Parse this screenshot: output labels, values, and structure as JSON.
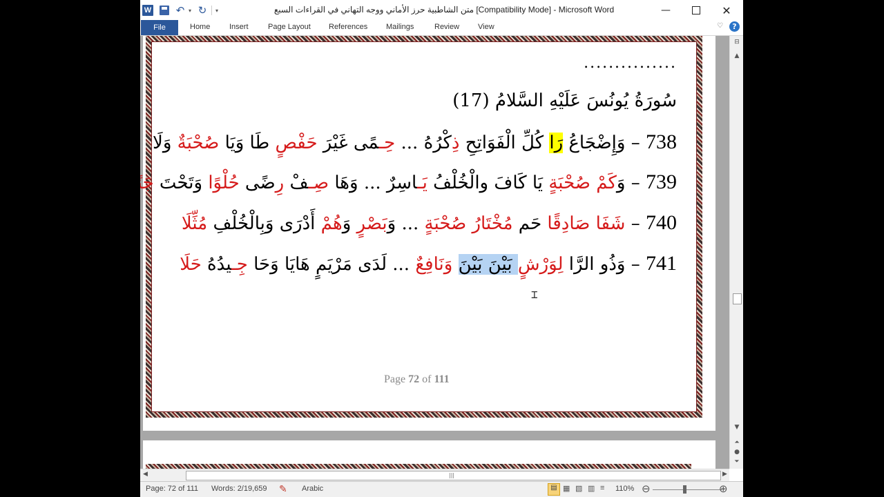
{
  "window": {
    "title": "متن الشاطبية حرز الأماني ووجه التهاني في القراءات السبع [Compatibility Mode] - Microsoft Word",
    "app_icon_letter": "W"
  },
  "quick_access": {
    "undo": "↶",
    "redo": "↻",
    "dropdown": "▾",
    "customize": "▾"
  },
  "controls": {
    "minimize": "—",
    "close": "✕"
  },
  "ribbon": {
    "file": "File",
    "tabs": [
      "Home",
      "Insert",
      "Page Layout",
      "References",
      "Mailings",
      "Review",
      "View"
    ],
    "collapse": "♡",
    "help": "?"
  },
  "document": {
    "dots": "...............",
    "surah_title": "سُورَةُ يُونُسَ عَلَيْهِ السَّلامُ (17)",
    "v738": {
      "num": "738",
      "a": " – وَإِضْجَاعُ ",
      "hl": "رَا",
      "b": " كُلِّ الْفَوَاتِحِ ",
      "r1": "ذِ",
      "c": "كْرُهُ ... ",
      "r2": "حِـ",
      "d": "مًى غَيْرَ ",
      "r3": "حَفْصٍ",
      "e": " طَا وَيَا ",
      "r4": "صُحْبَةٌ",
      "f": " وَلَا"
    },
    "v739": {
      "num": "739",
      "a": " – وَ",
      "r1": "كَمْ صُحْبَةٍ",
      "b": " يَا كَافَ والْخُلْفُ ",
      "r2": "يَـ",
      "c": "اسِرٌ ... وَهَا ",
      "r3": "صِـ",
      "d": "فْ ",
      "r4": "رِ",
      "e": "ضًى ",
      "r5": "حُلْوًا",
      "f": " وَتَحْتَ ",
      "r6": "جَنًى حَلَا"
    },
    "v740": {
      "num": "740",
      "a": " – ",
      "r1": "شَفَا",
      "b": " ",
      "r2": "صَادِقًا",
      "c": " حَم ",
      "r3": "مُخْتَارُ صُحْبَةٍ",
      "d": " ... وَ",
      "r4": "بَصْرٍ",
      "e": " وَ",
      "r5": "هُمْ",
      "f": " أَدْرَى وَبِالْخُلْفِ ",
      "r6": "مُثِّلَا"
    },
    "v741": {
      "num": "741",
      "a": " – وَذُو الرَّا ",
      "r1": "لِوَرْشٍ",
      "sel": " بَيْنَ بَيْنَ",
      "r2": " وَنَافِعٌ",
      "b": " ... لَدَى مَرْيَمٍ هَايَا وَحَا ",
      "r3": "جِـ",
      "c": "يدُهُ ",
      "r4": "حَلَا"
    },
    "page_indicator": {
      "prefix": "Page ",
      "current": "72",
      "of": " of ",
      "total": "111"
    }
  },
  "cursor": "⌶",
  "scroll": {
    "up": "▲",
    "down": "▼",
    "left": "◀",
    "right": "▶",
    "prev": "⏶",
    "browse": "●",
    "next": "⏷",
    "grip": "|||",
    "ruler": "⊟"
  },
  "status": {
    "page": "Page: 72 of 111",
    "words": "Words: 2/19,659",
    "language": "Arabic",
    "zoom": "110%",
    "zoom_out": "⊖",
    "zoom_in": "⊕",
    "views": [
      "▤",
      "▦",
      "▧",
      "▥",
      "≡"
    ]
  },
  "colors": {
    "accent": "#2b579a",
    "red_text": "#d51a1a",
    "highlight": "#ffff00",
    "selection": "#b5d3f3"
  }
}
